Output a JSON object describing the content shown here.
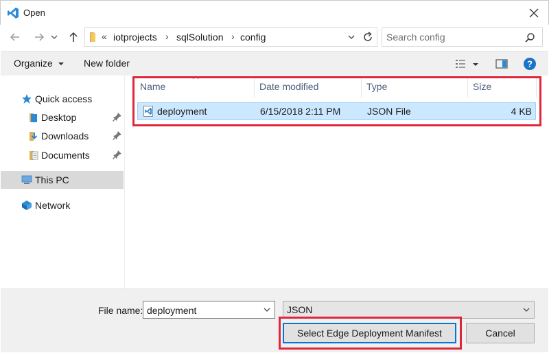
{
  "window": {
    "title": "Open"
  },
  "address": {
    "overflow": "«",
    "crumbs": [
      "iotprojects",
      "sqlSolution",
      "config"
    ],
    "separator": "›"
  },
  "search": {
    "placeholder": "Search config"
  },
  "toolbar": {
    "organize_label": "Organize",
    "new_folder_label": "New folder"
  },
  "nav": {
    "quick_access": "Quick access",
    "desktop": "Desktop",
    "downloads": "Downloads",
    "documents": "Documents",
    "this_pc": "This PC",
    "network": "Network"
  },
  "columns": {
    "name": "Name",
    "date": "Date modified",
    "type": "Type",
    "size": "Size"
  },
  "files": [
    {
      "name": "deployment",
      "date": "6/15/2018 2:11 PM",
      "type": "JSON File",
      "size": "4 KB"
    }
  ],
  "footer": {
    "file_name_label": "File name:",
    "file_name_value": "deployment",
    "file_type_value": "JSON",
    "open_button": "Select Edge Deployment Manifest",
    "cancel_button": "Cancel"
  },
  "colors": {
    "accent": "#0078d7",
    "selection": "#cce8ff",
    "highlight": "#e0263a",
    "help": "#1a73c8"
  }
}
